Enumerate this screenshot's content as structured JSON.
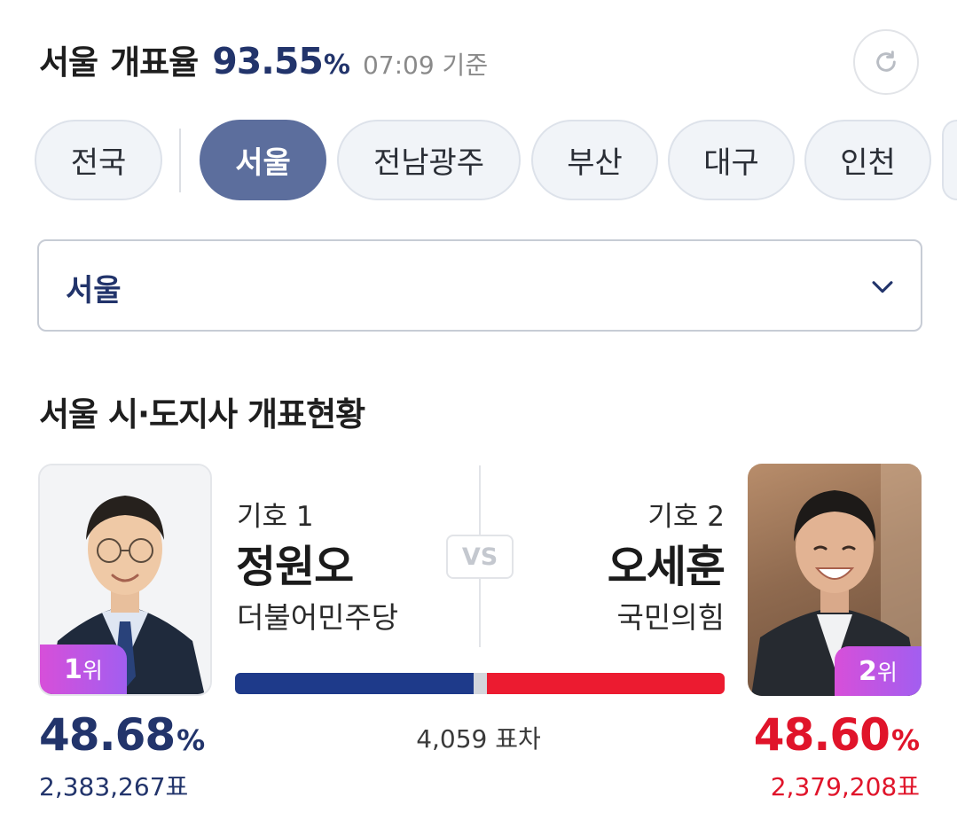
{
  "header": {
    "region": "서울",
    "label": "개표율",
    "rate": "93.55",
    "percent_sign": "%",
    "time": "07:09 기준",
    "refresh_icon": "refresh-icon"
  },
  "tabs": [
    {
      "label": "전국",
      "active": false
    },
    {
      "label": "서울",
      "active": true
    },
    {
      "label": "전남광주",
      "active": false
    },
    {
      "label": "부산",
      "active": false
    },
    {
      "label": "대구",
      "active": false
    },
    {
      "label": "인천",
      "active": false
    },
    {
      "label": "",
      "active": false
    }
  ],
  "dropdown": {
    "selected": "서울",
    "icon": "chevron-down-icon"
  },
  "section_title": "서울 시·도지사 개표현황",
  "vs_label": "VS",
  "candidates": [
    {
      "giho": "기호 1",
      "name": "정원오",
      "party": "더불어민주당",
      "rank_num": "1",
      "rank_suffix": "위",
      "percent": "48.68",
      "percent_sign": "%",
      "votes": "2,383,267표",
      "color": "#22346b"
    },
    {
      "giho": "기호 2",
      "name": "오세훈",
      "party": "국민의힘",
      "rank_num": "2",
      "rank_suffix": "위",
      "percent": "48.60",
      "percent_sign": "%",
      "votes": "2,379,208표",
      "color": "#e0142a"
    }
  ],
  "vote_margin": "4,059 표차",
  "bar": {
    "share_1": 48.68,
    "share_2": 48.6,
    "color_1": "#1e3a8a",
    "color_2": "#ec1b30"
  }
}
